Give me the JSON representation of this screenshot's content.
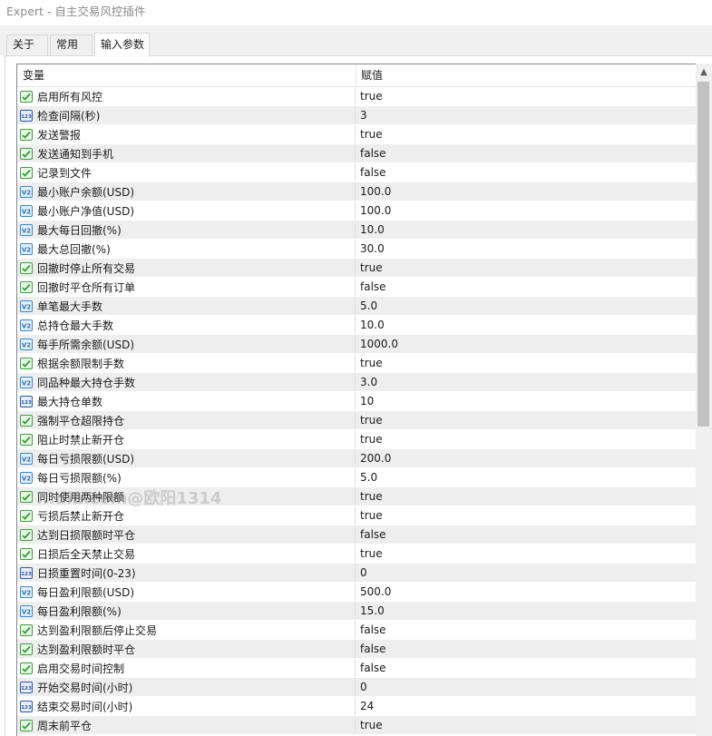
{
  "window": {
    "title": "Expert - 自主交易风控插件"
  },
  "tabs": [
    {
      "label": "关于"
    },
    {
      "label": "常用"
    },
    {
      "label": "输入参数"
    }
  ],
  "table": {
    "headers": {
      "name": "变量",
      "value": "赋值"
    },
    "rows": [
      {
        "icon": "bool",
        "name": "启用所有风控",
        "value": "true"
      },
      {
        "icon": "int",
        "name": "检查间隔(秒)",
        "value": "3"
      },
      {
        "icon": "bool",
        "name": "发送警报",
        "value": "true"
      },
      {
        "icon": "bool",
        "name": "发送通知到手机",
        "value": "false"
      },
      {
        "icon": "bool",
        "name": "记录到文件",
        "value": "false"
      },
      {
        "icon": "double",
        "name": "最小账户余额(USD)",
        "value": "100.0"
      },
      {
        "icon": "double",
        "name": "最小账户净值(USD)",
        "value": "100.0"
      },
      {
        "icon": "double",
        "name": "最大每日回撤(%)",
        "value": "10.0"
      },
      {
        "icon": "double",
        "name": "最大总回撤(%)",
        "value": "30.0"
      },
      {
        "icon": "bool",
        "name": "回撤时停止所有交易",
        "value": "true"
      },
      {
        "icon": "bool",
        "name": "回撤时平仓所有订单",
        "value": "false"
      },
      {
        "icon": "double",
        "name": "单笔最大手数",
        "value": "5.0"
      },
      {
        "icon": "double",
        "name": "总持仓最大手数",
        "value": "10.0"
      },
      {
        "icon": "double",
        "name": "每手所需余额(USD)",
        "value": "1000.0"
      },
      {
        "icon": "bool",
        "name": "根据余额限制手数",
        "value": "true"
      },
      {
        "icon": "double",
        "name": "同品种最大持仓手数",
        "value": "3.0"
      },
      {
        "icon": "int",
        "name": "最大持仓单数",
        "value": "10"
      },
      {
        "icon": "bool",
        "name": "强制平仓超限持仓",
        "value": "true"
      },
      {
        "icon": "bool",
        "name": "阻止时禁止新开仓",
        "value": "true"
      },
      {
        "icon": "double",
        "name": "每日亏损限额(USD)",
        "value": "200.0"
      },
      {
        "icon": "double",
        "name": "每日亏损限额(%)",
        "value": "5.0"
      },
      {
        "icon": "bool",
        "name": "同时使用两种限额",
        "value": "true"
      },
      {
        "icon": "bool",
        "name": "亏损后禁止新开仓",
        "value": "true"
      },
      {
        "icon": "bool",
        "name": "达到日损限额时平仓",
        "value": "false"
      },
      {
        "icon": "bool",
        "name": "日损后全天禁止交易",
        "value": "true"
      },
      {
        "icon": "int",
        "name": "日损重置时间(0-23)",
        "value": "0"
      },
      {
        "icon": "double",
        "name": "每日盈利限额(USD)",
        "value": "500.0"
      },
      {
        "icon": "double",
        "name": "每日盈利限额(%)",
        "value": "15.0"
      },
      {
        "icon": "bool",
        "name": "达到盈利限额后停止交易",
        "value": "false"
      },
      {
        "icon": "bool",
        "name": "达到盈利限额时平仓",
        "value": "false"
      },
      {
        "icon": "bool",
        "name": "启用交易时间控制",
        "value": "false"
      },
      {
        "icon": "int",
        "name": "开始交易时间(小时)",
        "value": "0"
      },
      {
        "icon": "int",
        "name": "结束交易时间(小时)",
        "value": "24"
      },
      {
        "icon": "bool",
        "name": "周末前平仓",
        "value": "true"
      }
    ]
  },
  "watermark": "...dia.com@欧阳1314",
  "colors": {
    "row_alt": "#eeeeee",
    "bool_icon": "#2f9e2f",
    "double_icon": "#3a86c8",
    "int_icon": "#2a5aa8"
  }
}
